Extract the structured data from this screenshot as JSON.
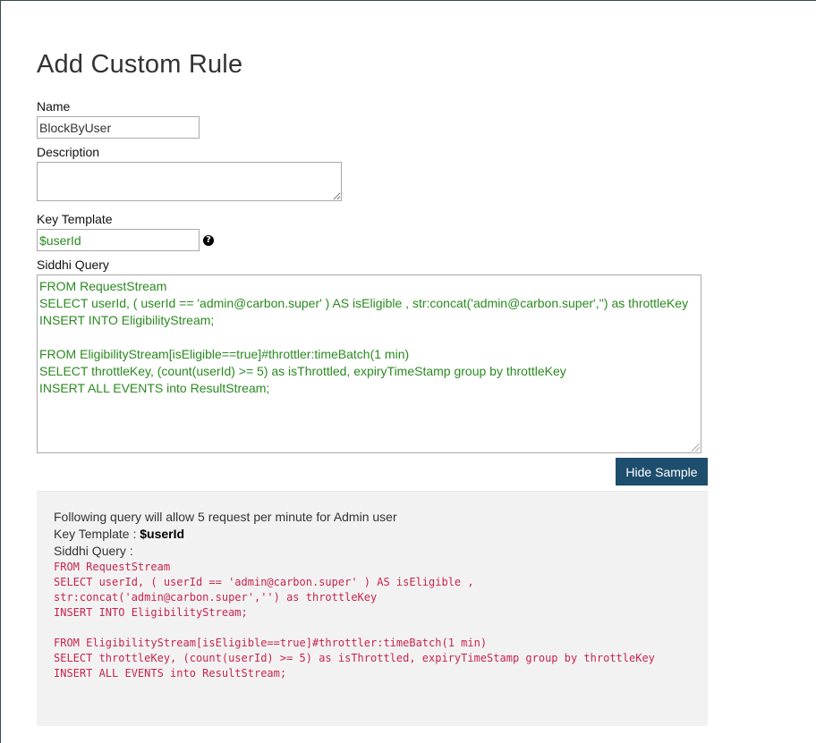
{
  "page": {
    "title": "Add Custom Rule"
  },
  "form": {
    "name_label": "Name",
    "name_value": "BlockByUser",
    "description_label": "Description",
    "description_value": "",
    "key_template_label": "Key Template",
    "key_template_value": "$userId",
    "siddhi_query_label": "Siddhi Query",
    "siddhi_query_lines": [
      "FROM RequestStream",
      "SELECT userId, ( userId == 'admin@carbon.super' ) AS isEligible , str:concat('admin@carbon.super','') as throttleKey",
      "INSERT INTO EligibilityStream;",
      "",
      "FROM EligibilityStream[isEligible==true]#throttler:timeBatch(1 min)",
      "SELECT throttleKey, (count(userId) >= 5) as isThrottled, expiryTimeStamp group by throttleKey",
      "INSERT ALL EVENTS into ResultStream;"
    ]
  },
  "buttons": {
    "hide_sample_label": "Hide Sample"
  },
  "sample": {
    "description": "Following query will allow 5 request per minute for Admin user",
    "key_template_prefix": "Key Template : ",
    "key_template_value": "$userId",
    "siddhi_query_label": "Siddhi Query :",
    "code": "FROM RequestStream\nSELECT userId, ( userId == 'admin@carbon.super' ) AS isEligible ,\nstr:concat('admin@carbon.super','') as throttleKey\nINSERT INTO EligibilityStream;\n\nFROM EligibilityStream[isEligible==true]#throttler:timeBatch(1 min)\nSELECT throttleKey, (count(userId) >= 5) as isThrottled, expiryTimeStamp group by throttleKey\nINSERT ALL EVENTS into ResultStream;"
  },
  "colors": {
    "accent_button": "#1d4e6e",
    "query_text": "#2a8a1f",
    "code_text": "#c7254e",
    "sample_background": "#f2f2f2"
  },
  "icons": {
    "key_template_help": "question-circle-icon"
  }
}
